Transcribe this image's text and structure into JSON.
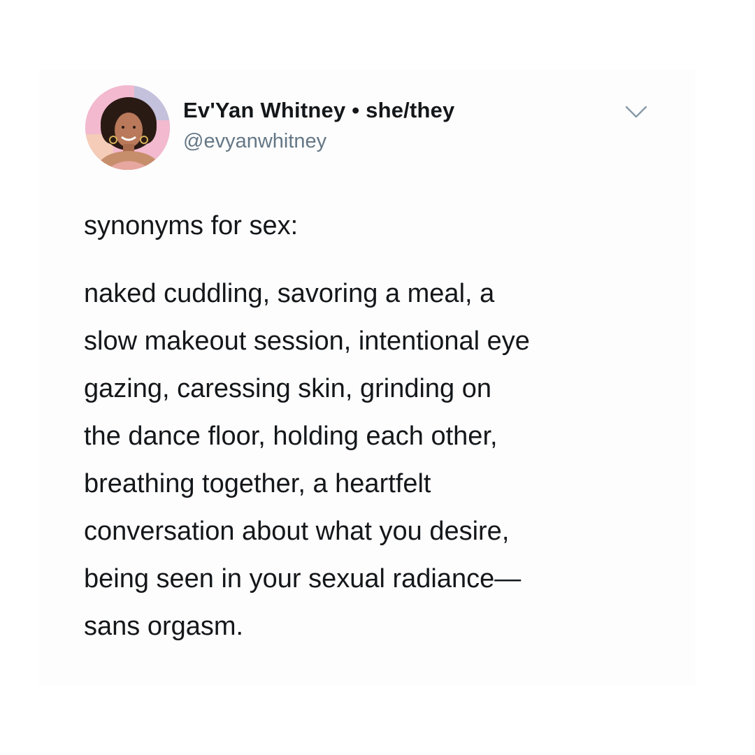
{
  "author": {
    "display_name": "Ev'Yan Whitney",
    "separator": "•",
    "pronouns": "she/they",
    "handle": "@evyanwhitney",
    "avatar_icon": "profile-photo"
  },
  "menu_icon": "chevron-down-icon",
  "tweet": {
    "intro": "synonyms for sex:",
    "lines": [
      "naked cuddling, savoring a meal, a",
      "slow makeout session, intentional eye",
      "gazing, caressing skin, grinding on",
      "the dance floor, holding each other,",
      "breathing together, a heartfelt",
      "conversation about what you desire,",
      "being seen in your sexual radiance—",
      "sans orgasm."
    ]
  },
  "colors": {
    "text_primary": "#14171a",
    "text_secondary": "#657786",
    "chevron": "#8899a6"
  }
}
